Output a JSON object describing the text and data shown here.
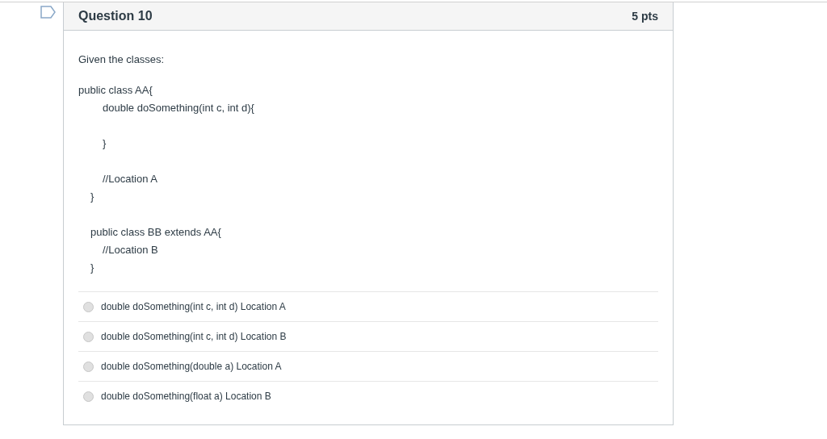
{
  "question": {
    "title": "Question 10",
    "points": "5 pts",
    "flagged": false
  },
  "prompt": "Given the classes:",
  "code_blocks": [
    {
      "lines": [
        {
          "text": "public class AA{",
          "kind": "top"
        },
        {
          "text": "double doSomething(int c, int d){",
          "kind": "member"
        }
      ]
    },
    {
      "lines": [
        {
          "text": "}",
          "kind": "member"
        }
      ]
    },
    {
      "lines": [
        {
          "text": "//Location A",
          "kind": "member"
        },
        {
          "text": "}",
          "kind": "inner"
        }
      ]
    },
    {
      "lines": [
        {
          "text": "public class BB extends AA{",
          "kind": "inner"
        },
        {
          "text": "//Location B",
          "kind": "member"
        },
        {
          "text": "}",
          "kind": "inner"
        }
      ]
    }
  ],
  "answers": [
    {
      "label": "double doSomething(int c, int d) Location A",
      "selected": false
    },
    {
      "label": "double doSomething(int c, int d) Location B",
      "selected": false
    },
    {
      "label": "double doSomething(double a) Location A",
      "selected": false
    },
    {
      "label": "double doSomething(float a) Location B",
      "selected": false
    }
  ]
}
